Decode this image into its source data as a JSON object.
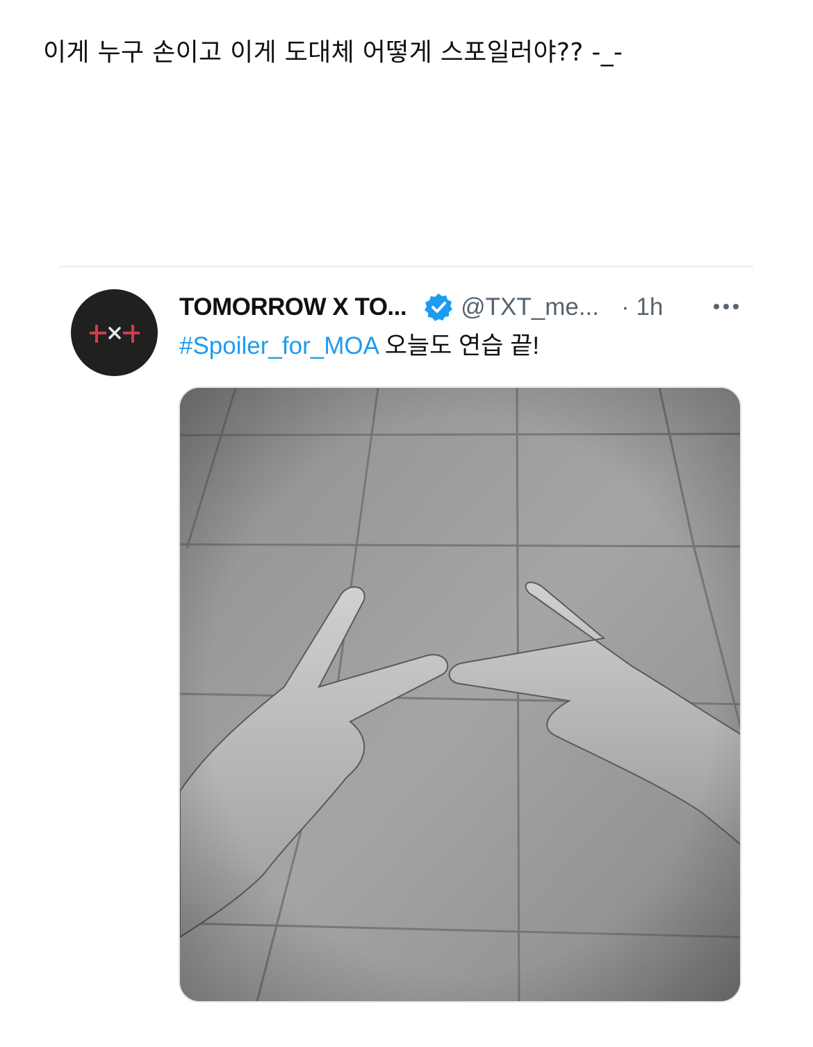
{
  "post": {
    "text": "이게 누구 손이고 이게 도대체 어떻게 스포일러야?? -_-"
  },
  "tweet": {
    "display_name": "TOMORROW X TO...",
    "handle": "@TXT_me...",
    "time": "· 1h",
    "hashtag": "#Spoiler_for_MOA",
    "body": " 오늘도 연습 끝!",
    "avatar_icon": "txt-logo-icon",
    "verified_icon": "verified-badge-icon",
    "more_icon": "more-options-icon",
    "photo": "grayscale-photo-two-hands-peace-signs-on-tiles"
  },
  "colors": {
    "hashtag": "#1d9bf0",
    "verified": "#1d9bf0",
    "muted": "#566370",
    "avatar_bg": "#202020",
    "logo_red": "#d23c4b"
  }
}
